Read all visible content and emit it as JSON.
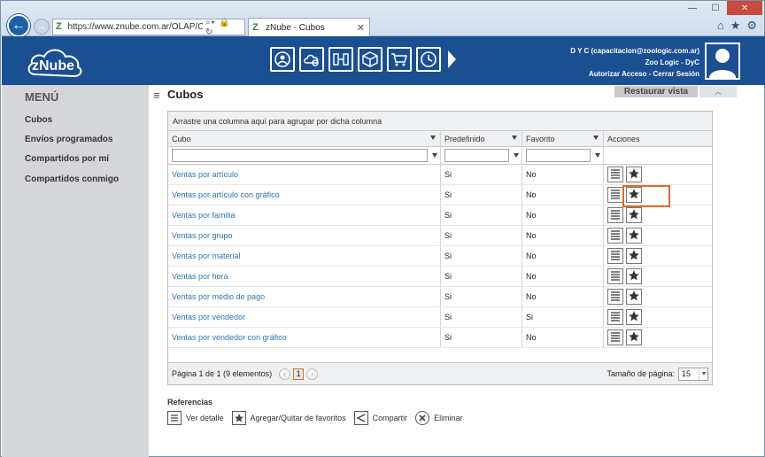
{
  "browser": {
    "url": "https://www.znube.com.ar/OLAP/Cubes",
    "tab_title": "zNube - Cubos",
    "favicon_letter": "Z",
    "window_controls": [
      "—",
      "☐",
      "✕"
    ],
    "right_icons": [
      "home-icon",
      "star-icon",
      "gear-icon"
    ]
  },
  "header": {
    "logo_text": "zNube",
    "modules": [
      "users-module-icon",
      "cloud-settings-module-icon",
      "structure-module-icon",
      "box-module-icon",
      "cart-module-icon",
      "clock-module-icon"
    ],
    "user_line": "D Y C (capacitacion@zoologic.com.ar)",
    "company_line": "Zoo Logic - DyC",
    "link_authorize": "Autorizar Acceso",
    "link_separator": " - ",
    "link_logout": "Cerrar Sesión"
  },
  "sidebar": {
    "title": "MENÚ",
    "items": [
      {
        "label": "Cubos"
      },
      {
        "label": "Envíos programados"
      },
      {
        "label": "Compartidos por mí"
      },
      {
        "label": "Compartidos conmigo"
      }
    ]
  },
  "main": {
    "title": "Cubos",
    "restore_label": "Restaurar vista",
    "collapse_symbol": "︿"
  },
  "grid": {
    "group_hint": "Arrastre una columna aquí para agrupar por dicha columna",
    "columns": [
      "Cubo",
      "Predefinido",
      "Favorito",
      "Acciones"
    ],
    "rows": [
      {
        "cubo": "Ventas por artículo",
        "predef": "Si",
        "fav": "No"
      },
      {
        "cubo": "Ventas por artículo con gráfico",
        "predef": "Si",
        "fav": "No"
      },
      {
        "cubo": "Ventas por familia",
        "predef": "Si",
        "fav": "No"
      },
      {
        "cubo": "Ventas por grupo",
        "predef": "Si",
        "fav": "No"
      },
      {
        "cubo": "Ventas por material",
        "predef": "Si",
        "fav": "No"
      },
      {
        "cubo": "Ventas por hora",
        "predef": "Si",
        "fav": "No"
      },
      {
        "cubo": "Ventas por medio de pago",
        "predef": "Si",
        "fav": "No"
      },
      {
        "cubo": "Ventas por vendedor",
        "predef": "Si",
        "fav": "Si"
      },
      {
        "cubo": "Ventas por vendedor con gráfico",
        "predef": "Si",
        "fav": "No"
      }
    ],
    "highlighted_row": 1,
    "pager": {
      "summary": "Página 1 de 1 (9 elementos)",
      "current_page": "1",
      "size_label": "Tamaño de página:",
      "size_value": "15"
    }
  },
  "references": {
    "title": "Referencias",
    "items": [
      {
        "label": "Ver detalle",
        "icon": "list-icon"
      },
      {
        "label": "Agregar/Quitar de favoritos",
        "icon": "star-icon"
      },
      {
        "label": "Compartir",
        "icon": "share-icon"
      },
      {
        "label": "Eliminar",
        "icon": "delete-icon"
      }
    ]
  },
  "colors": {
    "header_bg": "#1a4f92",
    "sidebar_bg": "#d4d6d9",
    "link": "#2e75b8",
    "highlight": "#e06b2a"
  }
}
